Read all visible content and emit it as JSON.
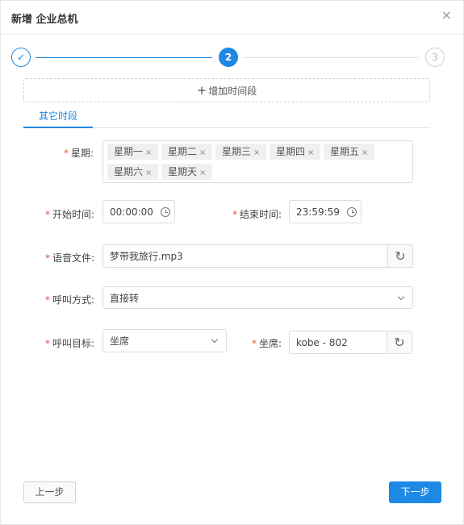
{
  "dialog": {
    "title": "新增 企业总机",
    "close_symbol": "×"
  },
  "steps": {
    "step1_symbol": "✓",
    "step2_label": "2",
    "step3_label": "3"
  },
  "add_period": {
    "label": "增加时间段",
    "plus": "+"
  },
  "tabs": {
    "active": "其它时段"
  },
  "form": {
    "weekdays": {
      "label": "星期:",
      "tags": [
        "星期一",
        "星期二",
        "星期三",
        "星期四",
        "星期五",
        "星期六",
        "星期天"
      ]
    },
    "start_time": {
      "label": "开始时间:",
      "value": "00:00:00"
    },
    "end_time": {
      "label": "结束时间:",
      "value": "23:59:59"
    },
    "voice_file": {
      "label": "语音文件:",
      "value": "梦带我旅行.mp3"
    },
    "call_mode": {
      "label": "呼叫方式:",
      "value": "直接转"
    },
    "call_target": {
      "label": "呼叫目标:",
      "value": "坐席"
    },
    "seat": {
      "label": "坐席:",
      "value": "kobe - 802"
    },
    "required_mark": "*",
    "tag_close": "×"
  },
  "footer": {
    "prev_label": "上一步",
    "next_label": "下一步"
  },
  "colors": {
    "primary": "#1e88e5",
    "required": "#e2553d",
    "border": "#dcdcdc",
    "tag_bg": "#f0f0f0"
  }
}
